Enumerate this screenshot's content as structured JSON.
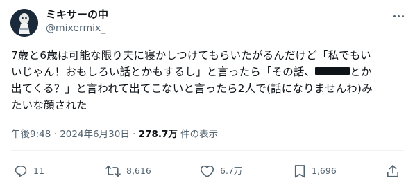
{
  "author": {
    "display_name": "ミキサーの中",
    "handle": "@mixermix_"
  },
  "post": {
    "lines": [
      "7歳と6歳は可能な限り夫に寝かしつけてもらいたがるんだけど「私でもい",
      "いじゃん！おもしろい話とかもするし」と言ったら「その話、",
      "とか",
      "出てくる？」と言われて出てこないと言ったら2人で(話になりませんわ)み",
      "たいな顔された"
    ],
    "timestamp": "午後9:48 · 2024年6月30日 · ",
    "views_count": "278.7万",
    "views_label": " 件の表示"
  },
  "actions": {
    "reply_count": "11",
    "repost_count": "8,616",
    "like_count": "6.7万",
    "bookmark_count": "1,696"
  },
  "icons": {
    "more": "more-icon",
    "reply": "reply-icon",
    "repost": "repost-icon",
    "like": "heart-icon",
    "bookmark": "bookmark-icon",
    "share": "share-icon"
  },
  "colors": {
    "text": "#0f1419",
    "secondary": "#536471",
    "divider": "#eff3f4"
  }
}
